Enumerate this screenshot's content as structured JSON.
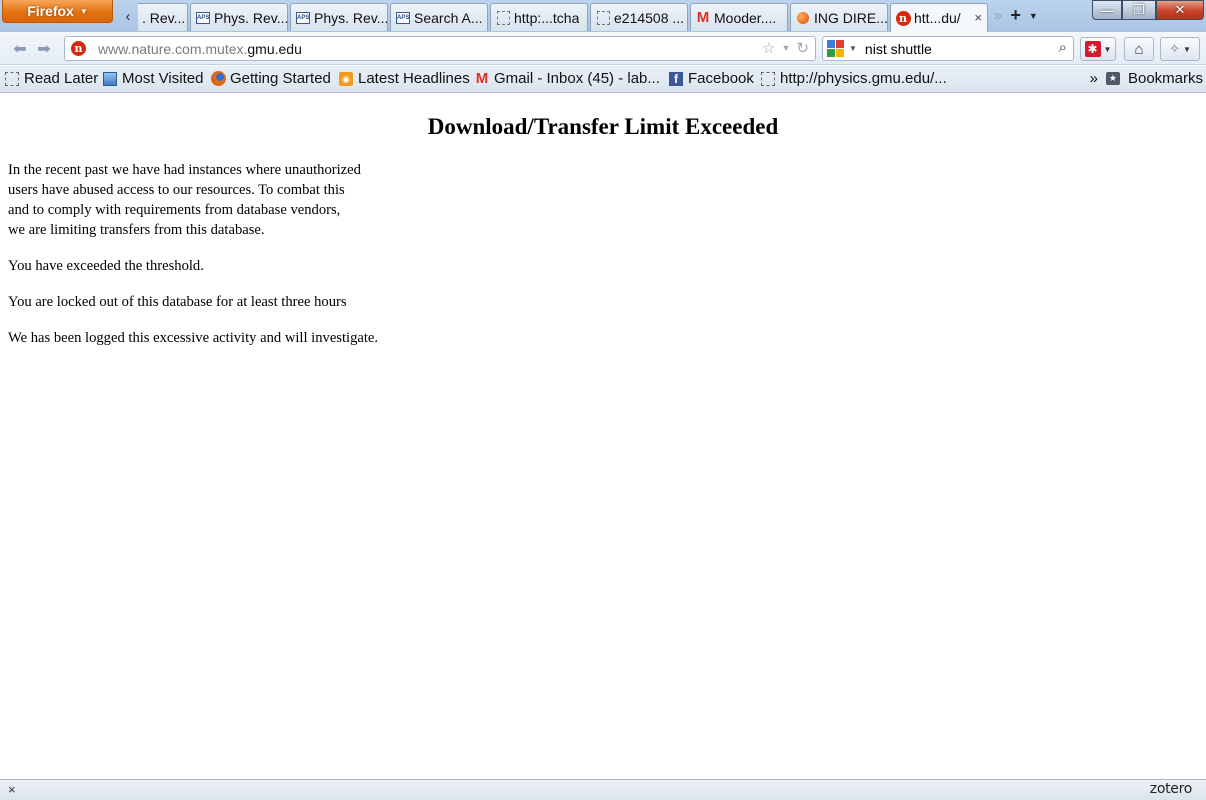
{
  "browser": {
    "menu_button": "Firefox",
    "tabs": [
      {
        "label": ". Rev...",
        "icon": "aps-icon"
      },
      {
        "label": "Phys. Rev...",
        "icon": "aps-icon"
      },
      {
        "label": "Phys. Rev...",
        "icon": "aps-icon"
      },
      {
        "label": "Search A...",
        "icon": "aps-icon"
      },
      {
        "label": "http:...tcha",
        "icon": "blank-page-icon"
      },
      {
        "label": "e214508 ...",
        "icon": "blank-page-icon"
      },
      {
        "label": "Mooder....",
        "icon": "gmail-icon"
      },
      {
        "label": "ING DIRE...",
        "icon": "orange-orb-icon"
      },
      {
        "label": "htt...du/",
        "icon": "nature-icon",
        "active": true
      }
    ],
    "tab_close_glyph": "×",
    "tab_overflow_glyph": "»",
    "new_tab_glyph": "+",
    "window_controls": {
      "minimize": "—",
      "maximize": "❐",
      "close": "✕"
    }
  },
  "navbar": {
    "url_gray": "www.nature.com.mutex.",
    "url_host": "gmu.edu",
    "search_value": "nist shuttle",
    "search_engine_icon": "google-icon"
  },
  "bookmarks": {
    "items": [
      {
        "label": "Read Later",
        "icon": "read-later-icon"
      },
      {
        "label": "Most Visited",
        "icon": "most-visited-icon"
      },
      {
        "label": "Getting Started",
        "icon": "firefox-icon"
      },
      {
        "label": "Latest Headlines",
        "icon": "rss-icon"
      },
      {
        "label": "Gmail - Inbox (45) - lab...",
        "icon": "gmail-icon"
      },
      {
        "label": "Facebook",
        "icon": "facebook-icon"
      },
      {
        "label": "http://physics.gmu.edu/...",
        "icon": "blank-page-icon"
      }
    ],
    "overflow": "»",
    "bookmarks_menu": "Bookmarks"
  },
  "page": {
    "heading": "Download/Transfer Limit Exceeded",
    "paragraph1_lines": [
      "In the recent past we have had instances where unauthorized",
      "users have abused access to our resources. To combat this",
      "and to comply with requirements from database vendors,",
      "we are limiting transfers from this database."
    ],
    "paragraph2": "You have exceeded the threshold.",
    "paragraph3": "You are locked out of this database for at least three hours",
    "paragraph4": "We has been logged this excessive activity and will investigate."
  },
  "statusbar": {
    "close_glyph": "×",
    "addon": "zotero"
  },
  "colors": {
    "firefox_orange": "#e4720f",
    "chrome_blue": "#bcd3ec",
    "close_red": "#c7432a",
    "nature_red": "#d6290e"
  }
}
